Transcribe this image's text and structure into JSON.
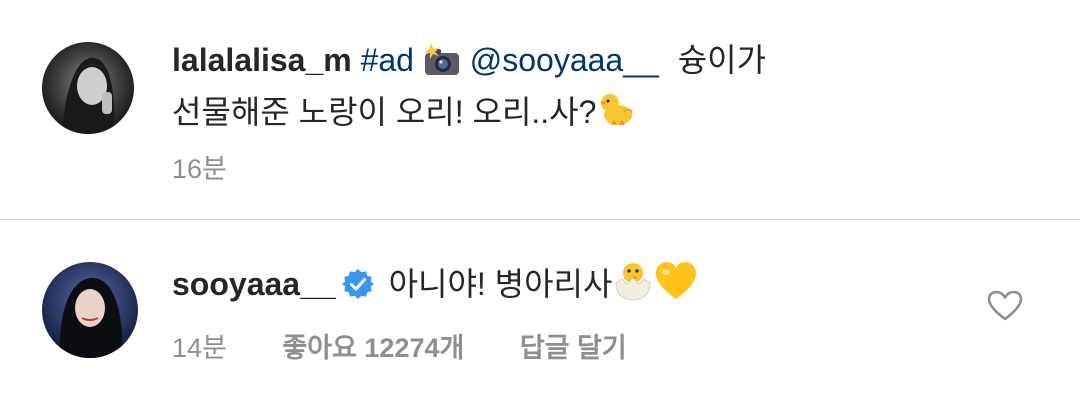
{
  "comments": [
    {
      "username": "lalalalisa_m",
      "hashtag": "#ad",
      "camera_emoji": "camera-with-flash",
      "mention": "@sooyaaa__",
      "text_line1_end": "슝이가",
      "text_line2": "선물해준 노랑이 오리! 오리..사?",
      "end_emoji": "baby-chick",
      "time": "16분",
      "verified": false
    },
    {
      "username": "sooyaaa__",
      "verified": true,
      "text": "아니야! 병아리사",
      "emojis": [
        "hatching-chick",
        "yellow-heart"
      ],
      "time": "14분",
      "likes": "좋아요 12274개",
      "reply": "답글 달기"
    }
  ],
  "colors": {
    "text": "#262626",
    "link": "#00376b",
    "meta": "#8e8e8e",
    "verified": "#3897f0",
    "divider": "#dbdbdb"
  }
}
